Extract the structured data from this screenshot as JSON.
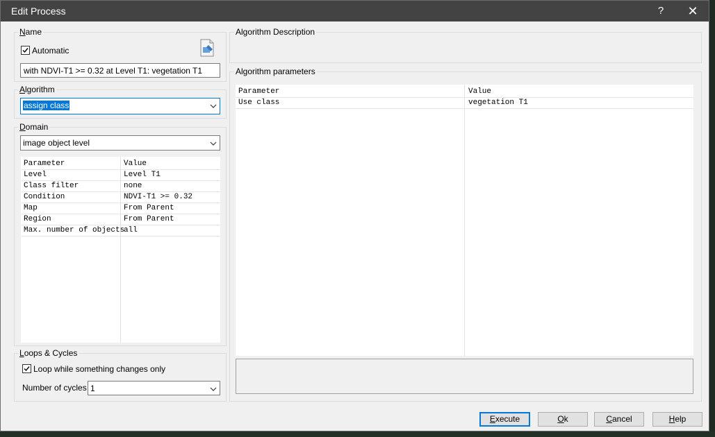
{
  "window": {
    "title": "Edit Process",
    "help_glyph": "?",
    "close_glyph": "✕"
  },
  "name_group": {
    "title": "Name",
    "automatic_label": "Automatic",
    "automatic_checked": true,
    "name_value": "with NDVI-T1 >= 0.32  at  Level T1: vegetation T1",
    "icon": "edit-name-icon"
  },
  "algorithm_group": {
    "title": "Algorithm",
    "selected": "assign class"
  },
  "domain_group": {
    "title": "Domain",
    "selected": "image object level",
    "headers": {
      "parameter": "Parameter",
      "value": "Value"
    },
    "rows": [
      {
        "parameter": "Level",
        "value": "Level T1"
      },
      {
        "parameter": "Class filter",
        "value": "none"
      },
      {
        "parameter": "Condition",
        "value": "NDVI-T1 >= 0.32"
      },
      {
        "parameter": "Map",
        "value": "From Parent"
      },
      {
        "parameter": "Region",
        "value": "From Parent"
      },
      {
        "parameter": "Max. number of objects",
        "value": "all"
      }
    ]
  },
  "loops_group": {
    "title": "Loops & Cycles",
    "loop_label": "Loop while something changes only",
    "loop_checked": true,
    "cycles_label": "Number of cycles",
    "cycles_value": "1"
  },
  "description_group": {
    "title": "Algorithm Description",
    "text": ""
  },
  "parameters_group": {
    "title": "Algorithm parameters",
    "headers": {
      "parameter": "Parameter",
      "value": "Value"
    },
    "rows": [
      {
        "parameter": "Use class",
        "value": "vegetation T1"
      }
    ]
  },
  "buttons": {
    "execute": "Execute",
    "ok": "Ok",
    "cancel": "Cancel",
    "help": "Help"
  }
}
